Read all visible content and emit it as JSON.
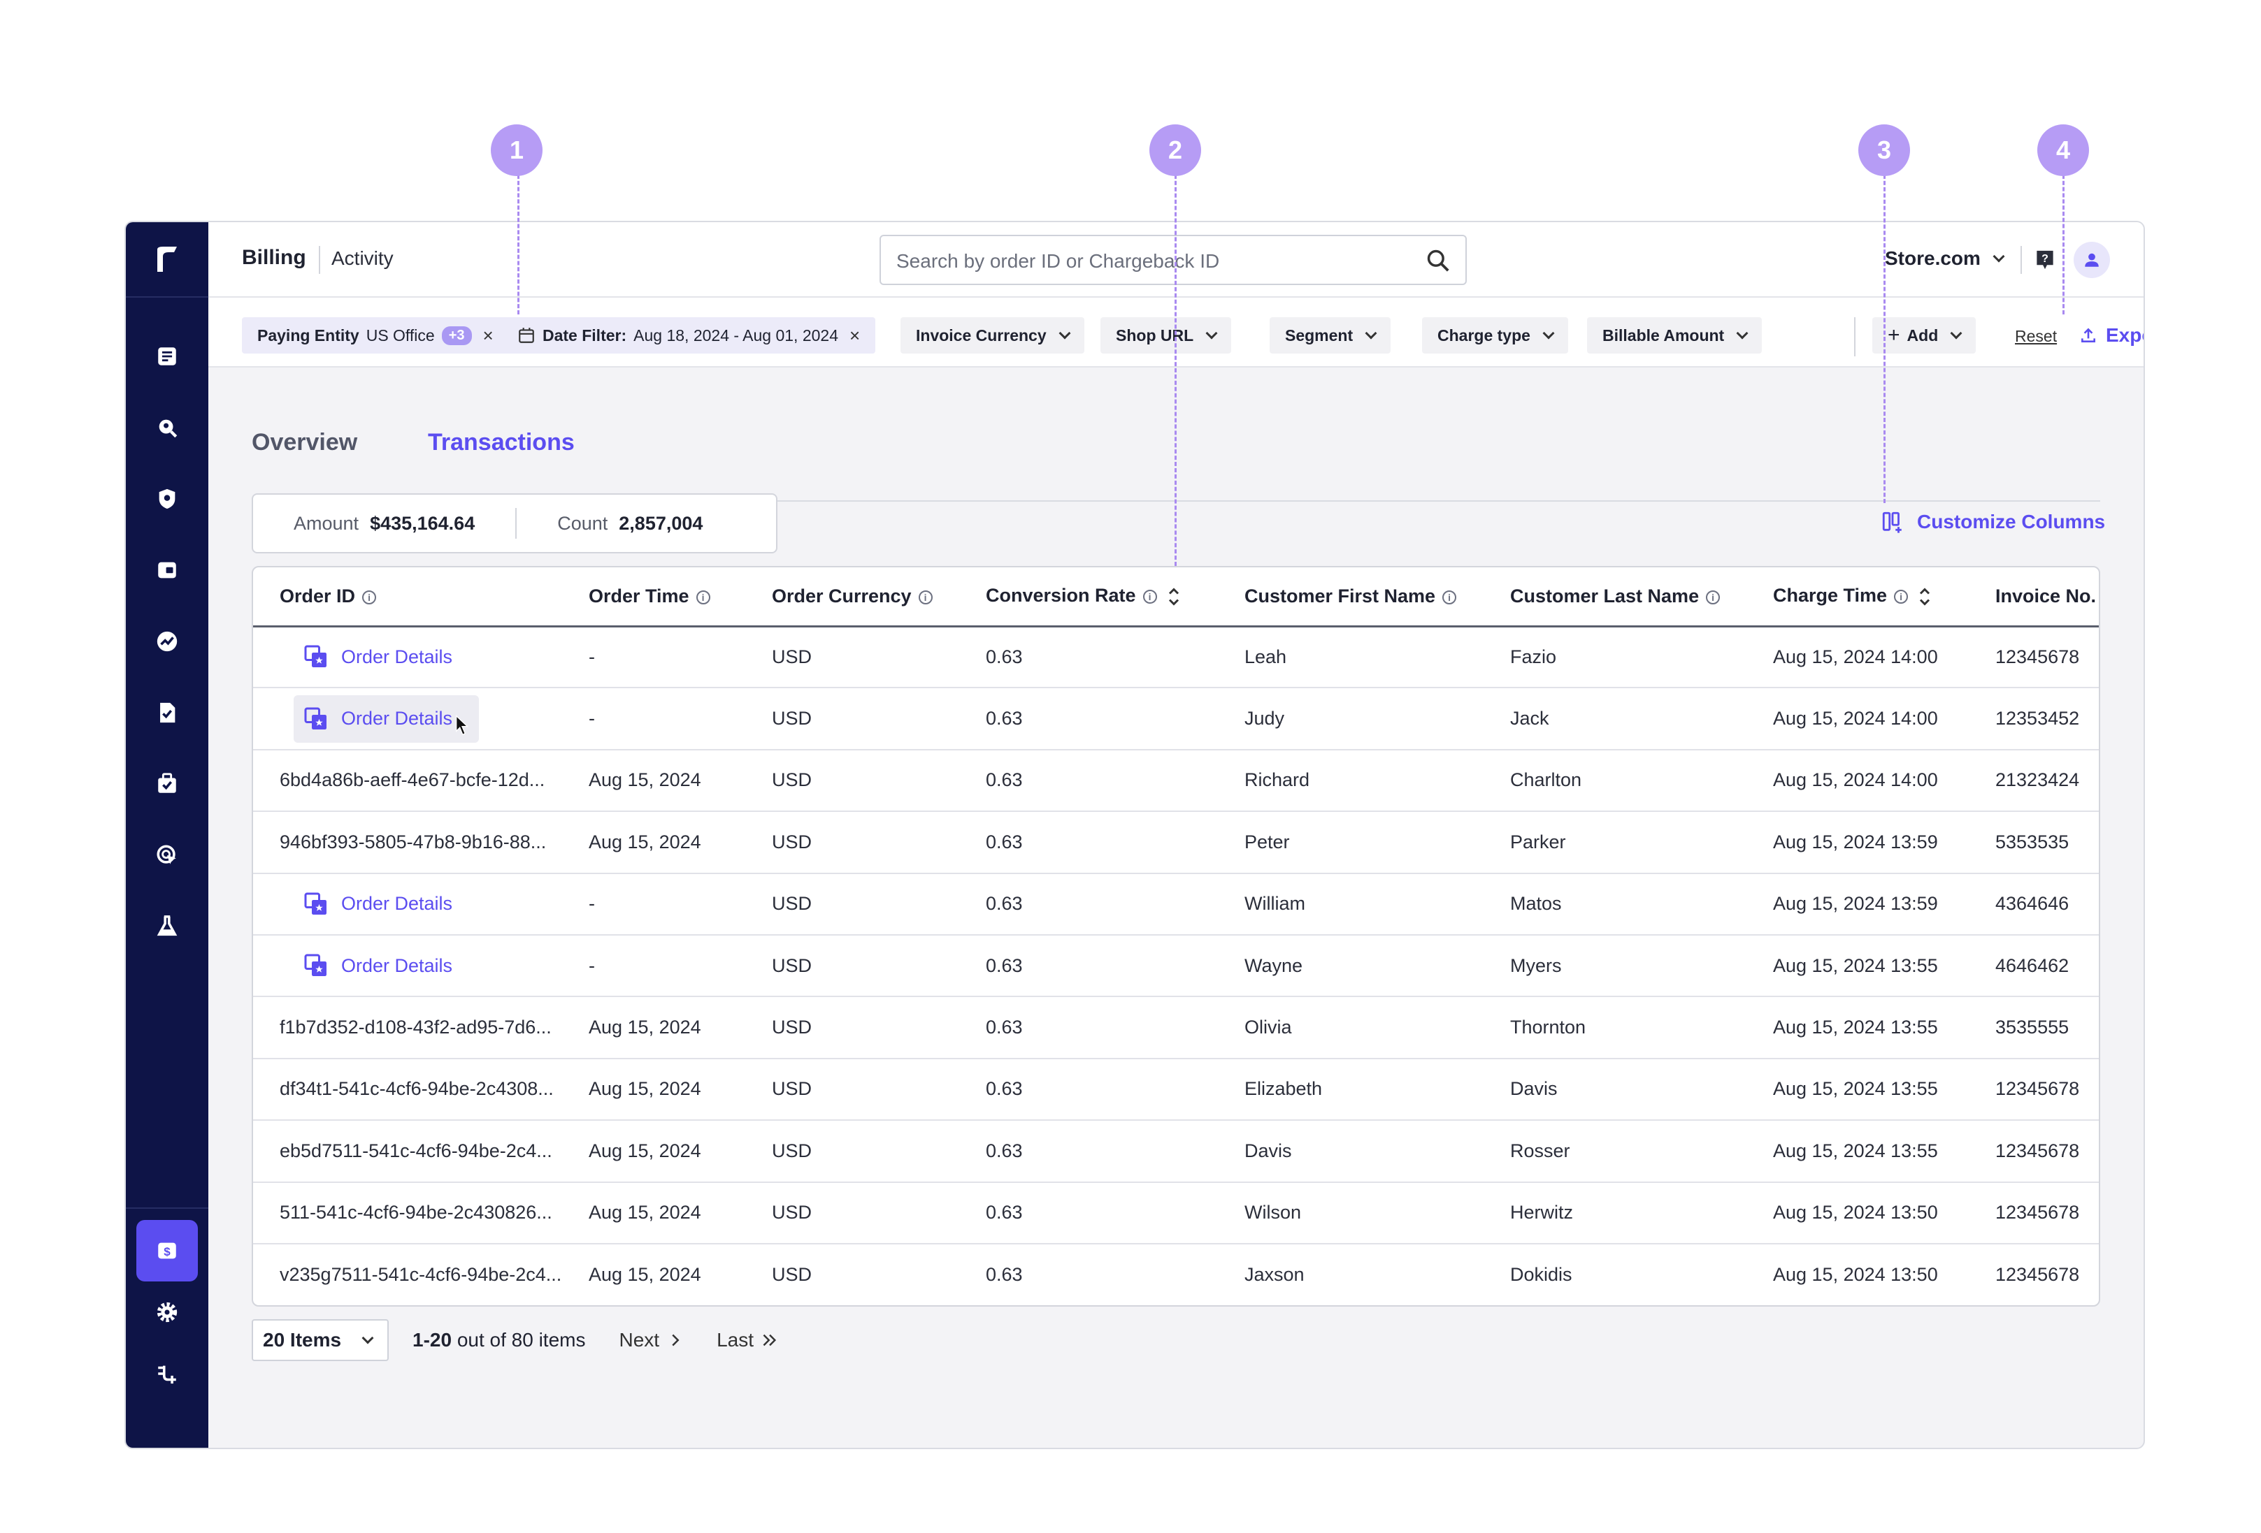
{
  "markers": [
    "1",
    "2",
    "3",
    "4"
  ],
  "header": {
    "title": "Billing",
    "subtitle": "Activity",
    "search_placeholder": "Search by order ID or Chargeback ID",
    "store": "Store.com"
  },
  "filters": {
    "paying_entity_label": "Paying Entity",
    "paying_entity_value": "US Office",
    "paying_entity_badge": "+3",
    "date_label": "Date Filter:",
    "date_value": "Aug 18, 2024 - Aug 01, 2024",
    "invoice_currency": "Invoice Currency",
    "shop_url": "Shop URL",
    "segment": "Segment",
    "charge_type": "Charge type",
    "billable_amount": "Billable Amount",
    "add": "Add",
    "reset": "Reset",
    "export": "Export"
  },
  "tabs": [
    "Overview",
    "Transactions"
  ],
  "active_tab": "Transactions",
  "summary": {
    "amount_label": "Amount",
    "amount_value": "$435,164.64",
    "count_label": "Count",
    "count_value": "2,857,004"
  },
  "customize_label": "Customize Columns",
  "table": {
    "columns": [
      "Order ID",
      "Order Time",
      "Order Currency",
      "Conversion Rate",
      "Customer First Name",
      "Customer Last Name",
      "Charge Time",
      "Invoice No."
    ],
    "rows": [
      {
        "order_id": "Order Details",
        "link": true,
        "order_time": "-",
        "currency": "USD",
        "rate": "0.63",
        "first": "Leah",
        "last": "Fazio",
        "charge_time": "Aug 15, 2024 14:00",
        "invoice": "12345678"
      },
      {
        "order_id": "Order Details",
        "link": true,
        "order_time": "-",
        "currency": "USD",
        "rate": "0.63",
        "first": "Judy",
        "last": "Jack",
        "charge_time": "Aug 15, 2024 14:00",
        "invoice": "12353452"
      },
      {
        "order_id": "6bd4a86b-aeff-4e67-bcfe-12d...",
        "link": false,
        "order_time": "Aug 15, 2024",
        "currency": "USD",
        "rate": "0.63",
        "first": "Richard",
        "last": "Charlton",
        "charge_time": "Aug 15, 2024 14:00",
        "invoice": "21323424"
      },
      {
        "order_id": "946bf393-5805-47b8-9b16-88...",
        "link": false,
        "order_time": "Aug 15, 2024",
        "currency": "USD",
        "rate": "0.63",
        "first": "Peter",
        "last": "Parker",
        "charge_time": "Aug 15, 2024 13:59",
        "invoice": "5353535"
      },
      {
        "order_id": "Order Details",
        "link": true,
        "order_time": "-",
        "currency": "USD",
        "rate": "0.63",
        "first": "William",
        "last": "Matos",
        "charge_time": "Aug 15, 2024 13:59",
        "invoice": "4364646"
      },
      {
        "order_id": "Order Details",
        "link": true,
        "order_time": "-",
        "currency": "USD",
        "rate": "0.63",
        "first": "Wayne",
        "last": "Myers",
        "charge_time": "Aug 15, 2024 13:55",
        "invoice": "4646462"
      },
      {
        "order_id": "f1b7d352-d108-43f2-ad95-7d6...",
        "link": false,
        "order_time": "Aug 15, 2024",
        "currency": "USD",
        "rate": "0.63",
        "first": "Olivia",
        "last": "Thornton",
        "charge_time": "Aug 15, 2024 13:55",
        "invoice": "3535555"
      },
      {
        "order_id": "df34t1-541c-4cf6-94be-2c4308...",
        "link": false,
        "order_time": "Aug 15, 2024",
        "currency": "USD",
        "rate": "0.63",
        "first": "Elizabeth",
        "last": "Davis",
        "charge_time": "Aug 15, 2024 13:55",
        "invoice": "12345678"
      },
      {
        "order_id": "eb5d7511-541c-4cf6-94be-2c4...",
        "link": false,
        "order_time": "Aug 15, 2024",
        "currency": "USD",
        "rate": "0.63",
        "first": "Davis",
        "last": "Rosser",
        "charge_time": "Aug 15, 2024 13:55",
        "invoice": "12345678"
      },
      {
        "order_id": "511-541c-4cf6-94be-2c430826...",
        "link": false,
        "order_time": "Aug 15, 2024",
        "currency": "USD",
        "rate": "0.63",
        "first": "Wilson",
        "last": "Herwitz",
        "charge_time": "Aug 15, 2024 13:50",
        "invoice": "12345678"
      },
      {
        "order_id": "v235g7511-541c-4cf6-94be-2c4...",
        "link": false,
        "order_time": "Aug 15, 2024",
        "currency": "USD",
        "rate": "0.63",
        "first": "Jaxson",
        "last": "Dokidis",
        "charge_time": "Aug 15, 2024 13:50",
        "invoice": "12345678"
      }
    ]
  },
  "pagination": {
    "items": "20 Items",
    "range": "1-20",
    "range_suffix": "out of 80 items",
    "next": "Next",
    "last": "Last"
  },
  "colors": {
    "accent": "#5b4df0",
    "sidebar": "#0e1447",
    "marker": "#b69cf5"
  }
}
